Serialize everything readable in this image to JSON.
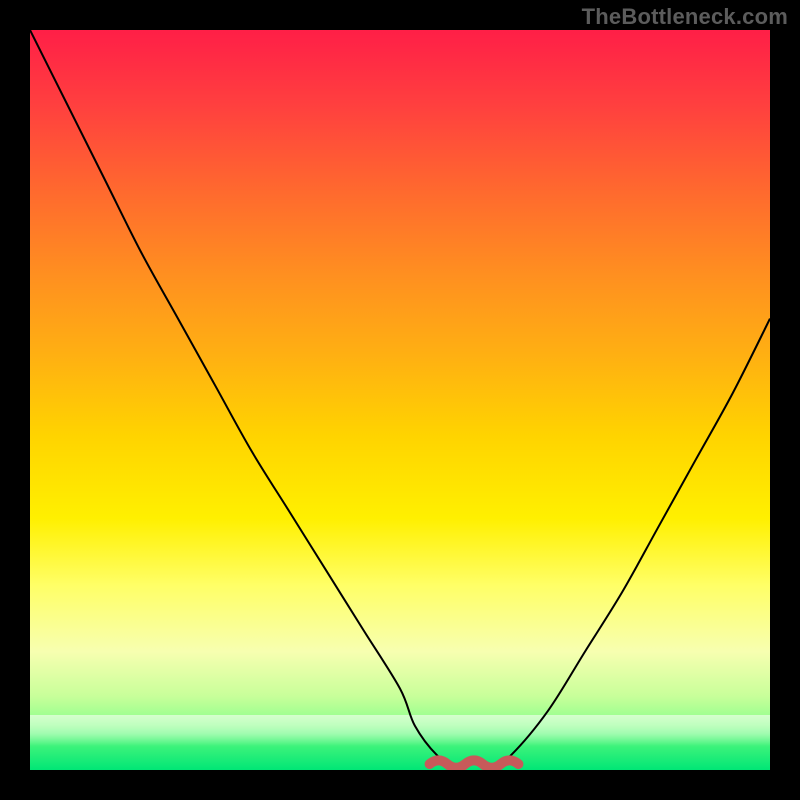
{
  "watermark": "TheBottleneck.com",
  "chart_data": {
    "type": "line",
    "title": "",
    "xlabel": "",
    "ylabel": "",
    "xlim": [
      0,
      100
    ],
    "ylim": [
      0,
      100
    ],
    "grid": false,
    "legend": false,
    "series": [
      {
        "name": "bottleneck-curve",
        "x": [
          0,
          5,
          10,
          15,
          20,
          25,
          30,
          35,
          40,
          45,
          50,
          52,
          55,
          58,
          62,
          65,
          70,
          75,
          80,
          85,
          90,
          95,
          100
        ],
        "y": [
          100,
          90,
          80,
          70,
          61,
          52,
          43,
          35,
          27,
          19,
          11,
          6,
          2,
          0,
          0,
          2,
          8,
          16,
          24,
          33,
          42,
          51,
          61
        ]
      }
    ],
    "annotations": [
      {
        "name": "rough-minimum-marker",
        "x_range": [
          54,
          66
        ],
        "y": 0
      }
    ],
    "background_gradient": {
      "direction": "vertical",
      "stops": [
        {
          "pos": 0.0,
          "color": "#ff1f47"
        },
        {
          "pos": 0.33,
          "color": "#ff8f20"
        },
        {
          "pos": 0.66,
          "color": "#fff000"
        },
        {
          "pos": 0.9,
          "color": "#c8ff9a"
        },
        {
          "pos": 1.0,
          "color": "#00e676"
        }
      ]
    }
  }
}
